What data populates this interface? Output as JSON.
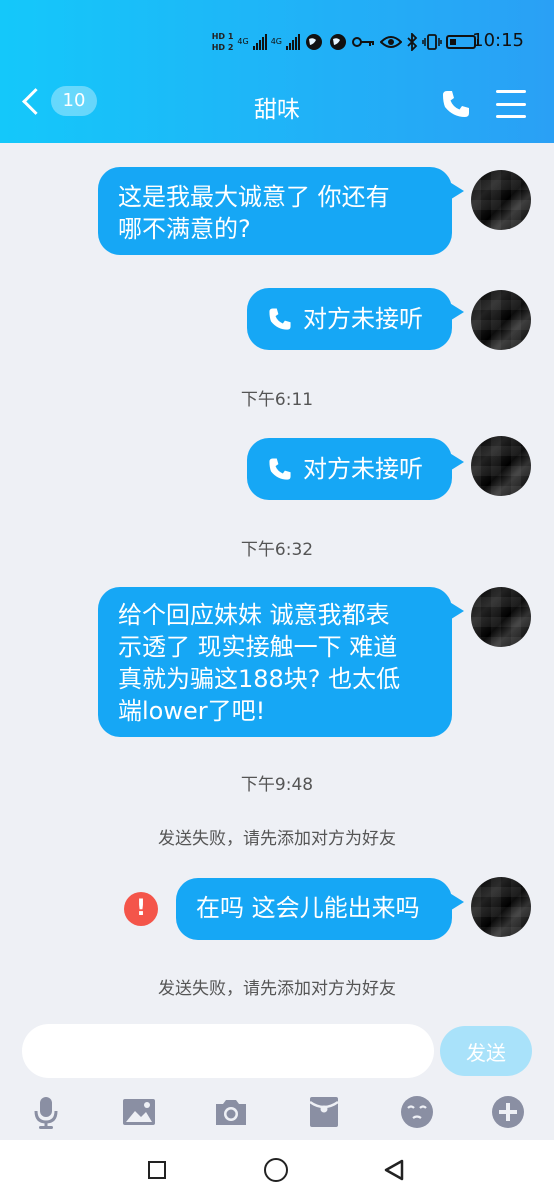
{
  "status_bar": {
    "time": "10:15",
    "hd1": "HD 1",
    "hd2": "HD 2",
    "network1": "4G",
    "network2": "4G"
  },
  "header": {
    "title": "甜味",
    "unread_count": "10",
    "accent_color": "#1aa6f5"
  },
  "messages": [
    {
      "type": "text",
      "text": "这是我最大诚意了 你还有\n哪不满意的?"
    },
    {
      "type": "call",
      "text": "对方未接听"
    },
    {
      "type": "time",
      "text": "下午6:11"
    },
    {
      "type": "call",
      "text": "对方未接听"
    },
    {
      "type": "time",
      "text": "下午6:32"
    },
    {
      "type": "text",
      "text": "给个回应妹妹 诚意我都表\n示透了 现实接触一下 难道\n真就为骗这188块? 也太低\n端lower了吧!"
    },
    {
      "type": "time",
      "text": "下午9:48"
    },
    {
      "type": "notice",
      "text": "发送失败，请先添加对方为好友"
    },
    {
      "type": "text",
      "text": "在吗 这会儿能出来吗",
      "failed": true
    },
    {
      "type": "notice",
      "text": "发送失败，请先添加对方为好友"
    }
  ],
  "composer": {
    "input_value": "",
    "send_label": "发送"
  },
  "toolbar": {
    "icons": [
      "mic-icon",
      "image-icon",
      "camera-icon",
      "red-packet-icon",
      "emoji-icon",
      "plus-icon"
    ]
  }
}
